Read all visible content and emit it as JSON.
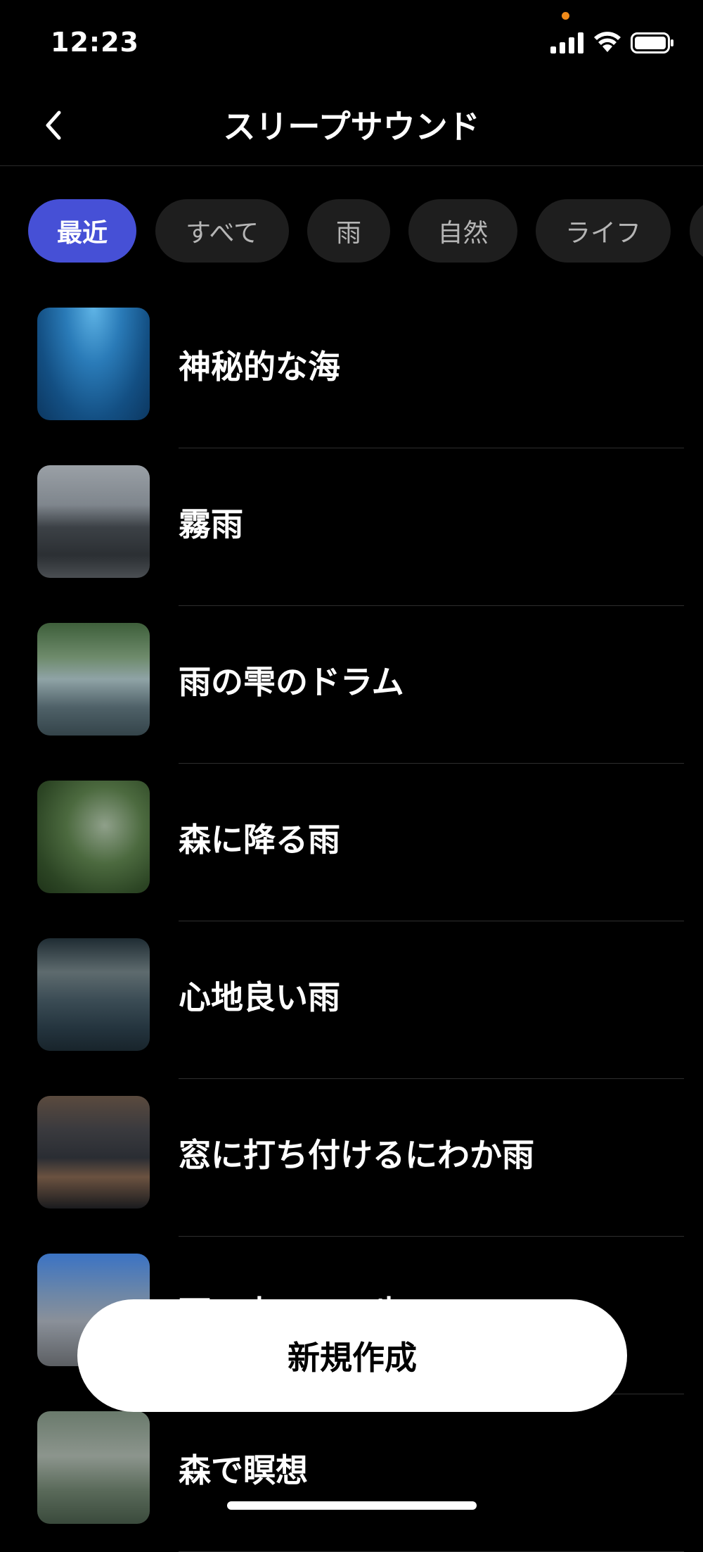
{
  "status": {
    "time": "12:23"
  },
  "nav": {
    "title": "スリープサウンド"
  },
  "chips": [
    "最近",
    "すべて",
    "雨",
    "自然",
    "ライフ"
  ],
  "items": [
    {
      "title": "神秘的な海",
      "thumb": "ocean-water"
    },
    {
      "title": "霧雨",
      "thumb": "rainy-city"
    },
    {
      "title": "雨の雫のドラム",
      "thumb": "rain-drops-pavement"
    },
    {
      "title": "森に降る雨",
      "thumb": "rain-forest-leaves"
    },
    {
      "title": "心地良い雨",
      "thumb": "blurry-rain"
    },
    {
      "title": "窓に打ち付けるにわか雨",
      "thumb": "rain-on-window"
    },
    {
      "title": "雨の中…の…歩",
      "thumb": "rain-boots-puddle"
    },
    {
      "title": "森で瞑想",
      "thumb": "misty-forest"
    }
  ],
  "fab": {
    "label": "新規作成"
  },
  "colors": {
    "accent": "#4650d6",
    "chip_bg": "#1e1e1e",
    "background": "#000000"
  }
}
